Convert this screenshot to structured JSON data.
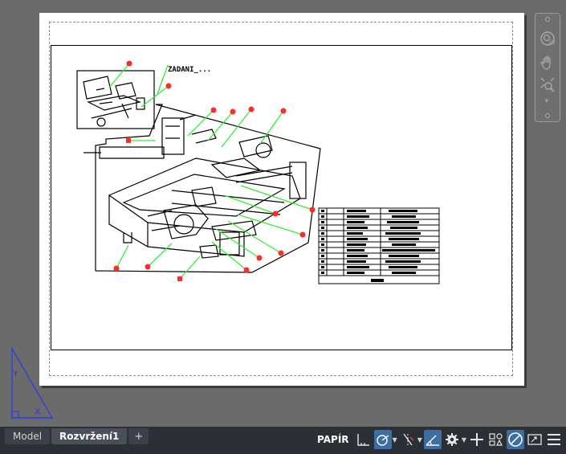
{
  "app": {
    "view_type": "AutoCAD layout (paper space)",
    "accent_color": "#3c6da3",
    "leader_color": "#33ee33",
    "balloon_color": "#ff2a2a"
  },
  "drawing": {
    "title_text": "ZADANI_..."
  },
  "navigation_bar": {
    "icons": [
      "steering-wheel-icon",
      "pan-icon",
      "zoom-extents-icon"
    ]
  },
  "ucs_icon": {
    "axis_y": "Y",
    "axis_x": "X"
  },
  "layout_tabs": {
    "items": [
      {
        "label": "Model",
        "active": false
      },
      {
        "label": "Rozvržení1",
        "active": true
      }
    ],
    "add_label": "+"
  },
  "status_bar": {
    "space_label": "PAPÍR",
    "buttons": [
      {
        "icon": "snap-mode-icon",
        "on": false
      },
      {
        "icon": "polar-tracking-icon",
        "on": true
      },
      {
        "icon": "object-snap-tracking-icon",
        "on": false
      },
      {
        "icon": "dynamic-ucs-icon",
        "on": true
      },
      {
        "icon": "workspace-gear-icon",
        "on": false
      },
      {
        "icon": "plus-icon",
        "on": false
      },
      {
        "icon": "annotation-scale-icon",
        "on": false
      },
      {
        "icon": "hardware-acceleration-icon",
        "on": true
      },
      {
        "icon": "fullscreen-icon",
        "on": false
      },
      {
        "icon": "customize-menu-icon",
        "on": false
      }
    ]
  }
}
